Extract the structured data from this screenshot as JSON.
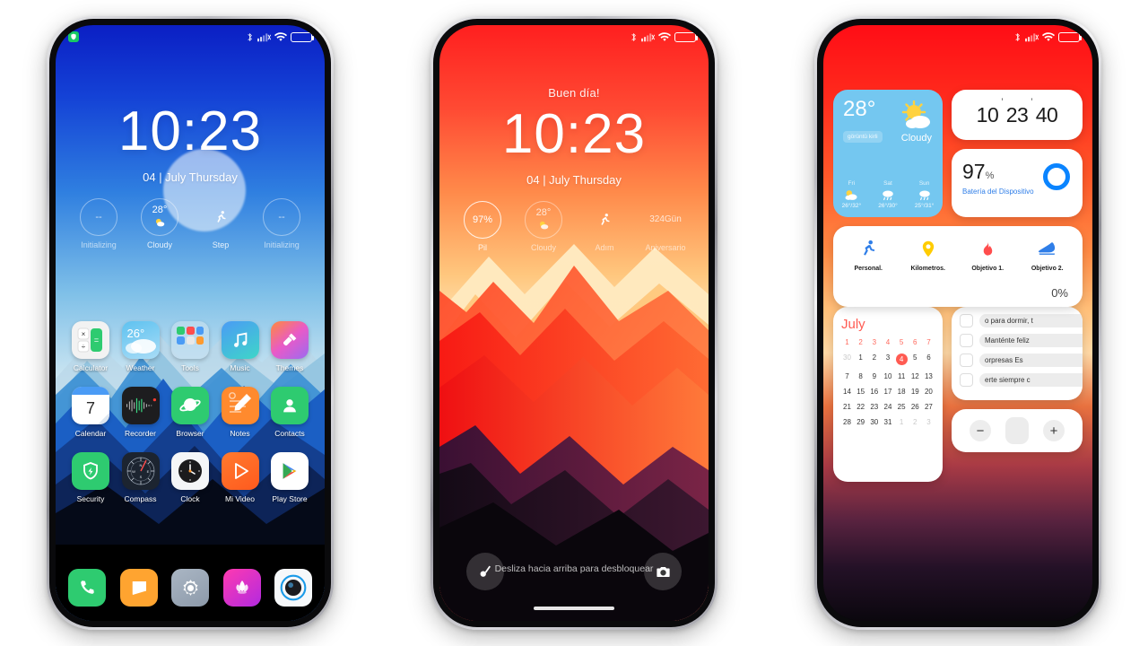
{
  "statusbar": {
    "icons": [
      "bluetooth-icon",
      "signal-icon",
      "wifi-icon",
      "battery-icon"
    ],
    "security_badge": "security-badge-icon"
  },
  "phone1": {
    "type": "home-screen",
    "clock": "10:23",
    "date": "04 | July Thursday",
    "lock_widgets": [
      {
        "value": "--",
        "label": "Initializing",
        "icon": "none"
      },
      {
        "value": "28°",
        "label": "Cloudy",
        "icon": "sun-cloud-icon"
      },
      {
        "value": "",
        "label": "Step",
        "icon": "runner-icon"
      },
      {
        "value": "--",
        "label": "Initializing",
        "icon": "none"
      }
    ],
    "apps": [
      [
        {
          "label": "Calculator",
          "icon": "calculator-icon"
        },
        {
          "label": "Weather",
          "icon": "weather-icon",
          "value": "26°"
        },
        {
          "label": "Tools",
          "icon": "tools-folder-icon"
        },
        {
          "label": "Music",
          "icon": "music-icon"
        },
        {
          "label": "Themes",
          "icon": "themes-icon"
        }
      ],
      [
        {
          "label": "Calendar",
          "icon": "calendar-icon",
          "value": "7"
        },
        {
          "label": "Recorder",
          "icon": "recorder-icon"
        },
        {
          "label": "Browser",
          "icon": "browser-icon"
        },
        {
          "label": "Notes",
          "icon": "notes-icon"
        },
        {
          "label": "Contacts",
          "icon": "contacts-icon"
        }
      ],
      [
        {
          "label": "Security",
          "icon": "security-shield-icon"
        },
        {
          "label": "Compass",
          "icon": "compass-icon"
        },
        {
          "label": "Clock",
          "icon": "clock-icon"
        },
        {
          "label": "Mi Video",
          "icon": "mi-video-icon"
        },
        {
          "label": "Play Store",
          "icon": "play-store-icon"
        }
      ]
    ],
    "dock": [
      {
        "label": "Phone",
        "icon": "phone-icon"
      },
      {
        "label": "Messages",
        "icon": "messages-icon"
      },
      {
        "label": "Settings",
        "icon": "settings-gear-icon"
      },
      {
        "label": "Themes",
        "icon": "lotus-themes-icon"
      },
      {
        "label": "Camera",
        "icon": "camera-icon"
      }
    ]
  },
  "phone2": {
    "type": "lock-screen",
    "greeting": "Buen día!",
    "clock": "10:23",
    "date": "04 | July Thursday",
    "lock_widgets": [
      {
        "value": "97%",
        "label": "Pil",
        "icon": "ring-icon"
      },
      {
        "value": "28°",
        "label": "Cloudy",
        "icon": "sun-cloud-icon"
      },
      {
        "value": "",
        "label": "Adım",
        "icon": "runner-icon"
      },
      {
        "value": "324Gün",
        "label": "Aniversario",
        "icon": "none"
      }
    ],
    "unlock_hint": "Desliza hacia arriba para desbloquear",
    "left_button": "flashlight-icon",
    "right_button": "camera-icon"
  },
  "phone3": {
    "type": "widget-screen",
    "weather": {
      "temp": "28°",
      "chip": "görüntü kirli",
      "condition": "Cloudy",
      "icon": "sun-cloud-icon",
      "forecast": [
        {
          "day": "Fri",
          "icon": "sun-cloud-icon",
          "temp": "26°/32°"
        },
        {
          "day": "Sat",
          "icon": "rain-icon",
          "temp": "26°/30°"
        },
        {
          "day": "Sun",
          "icon": "rain-icon",
          "temp": "25°/31°"
        }
      ]
    },
    "clock_widget": {
      "hours": "10",
      "minutes": "23",
      "seconds": "40",
      "sep": "’"
    },
    "battery_widget": {
      "value": "97",
      "unit": "%",
      "label": "Batería del Dispositivo",
      "ring_color": "#0a84ff"
    },
    "fitness": {
      "items": [
        {
          "label": "Personal.",
          "icon": "runner-icon",
          "color": "#2f7ee8"
        },
        {
          "label": "Kilometros.",
          "icon": "map-pin-icon",
          "color": "#ffcc00"
        },
        {
          "label": "Objetivo 1.",
          "icon": "flame-icon",
          "color": "#ff4d4d"
        },
        {
          "label": "Objetivo 2.",
          "icon": "shoe-icon",
          "color": "#2f7ee8"
        }
      ],
      "percent": "0%"
    },
    "calendar": {
      "title": "July",
      "header": [
        "1",
        "2",
        "3",
        "4",
        "5",
        "6",
        "7"
      ],
      "weeks": [
        [
          {
            "d": "30",
            "m": true
          },
          {
            "d": "1"
          },
          {
            "d": "2"
          },
          {
            "d": "3"
          },
          {
            "d": "4",
            "sel": true
          },
          {
            "d": "5"
          },
          {
            "d": "6"
          }
        ],
        [
          {
            "d": "7"
          },
          {
            "d": "8"
          },
          {
            "d": "9"
          },
          {
            "d": "10"
          },
          {
            "d": "11"
          },
          {
            "d": "12"
          },
          {
            "d": "13"
          }
        ],
        [
          {
            "d": "14"
          },
          {
            "d": "15"
          },
          {
            "d": "16"
          },
          {
            "d": "17"
          },
          {
            "d": "18"
          },
          {
            "d": "19"
          },
          {
            "d": "20"
          }
        ],
        [
          {
            "d": "21"
          },
          {
            "d": "22"
          },
          {
            "d": "23"
          },
          {
            "d": "24"
          },
          {
            "d": "25"
          },
          {
            "d": "26"
          },
          {
            "d": "27"
          }
        ],
        [
          {
            "d": "28"
          },
          {
            "d": "29"
          },
          {
            "d": "30"
          },
          {
            "d": "31"
          },
          {
            "d": "1",
            "m": true
          },
          {
            "d": "2",
            "m": true
          },
          {
            "d": "3",
            "m": true
          }
        ]
      ]
    },
    "todo": {
      "items": [
        {
          "text": "o para dormir, t",
          "checked": false
        },
        {
          "text": "Manténte feliz",
          "checked": false
        },
        {
          "text": "orpresas        Es",
          "checked": false
        },
        {
          "text": "erte siempre c",
          "checked": false
        }
      ]
    },
    "stepper": {
      "minus": "−",
      "plus": "+"
    }
  }
}
